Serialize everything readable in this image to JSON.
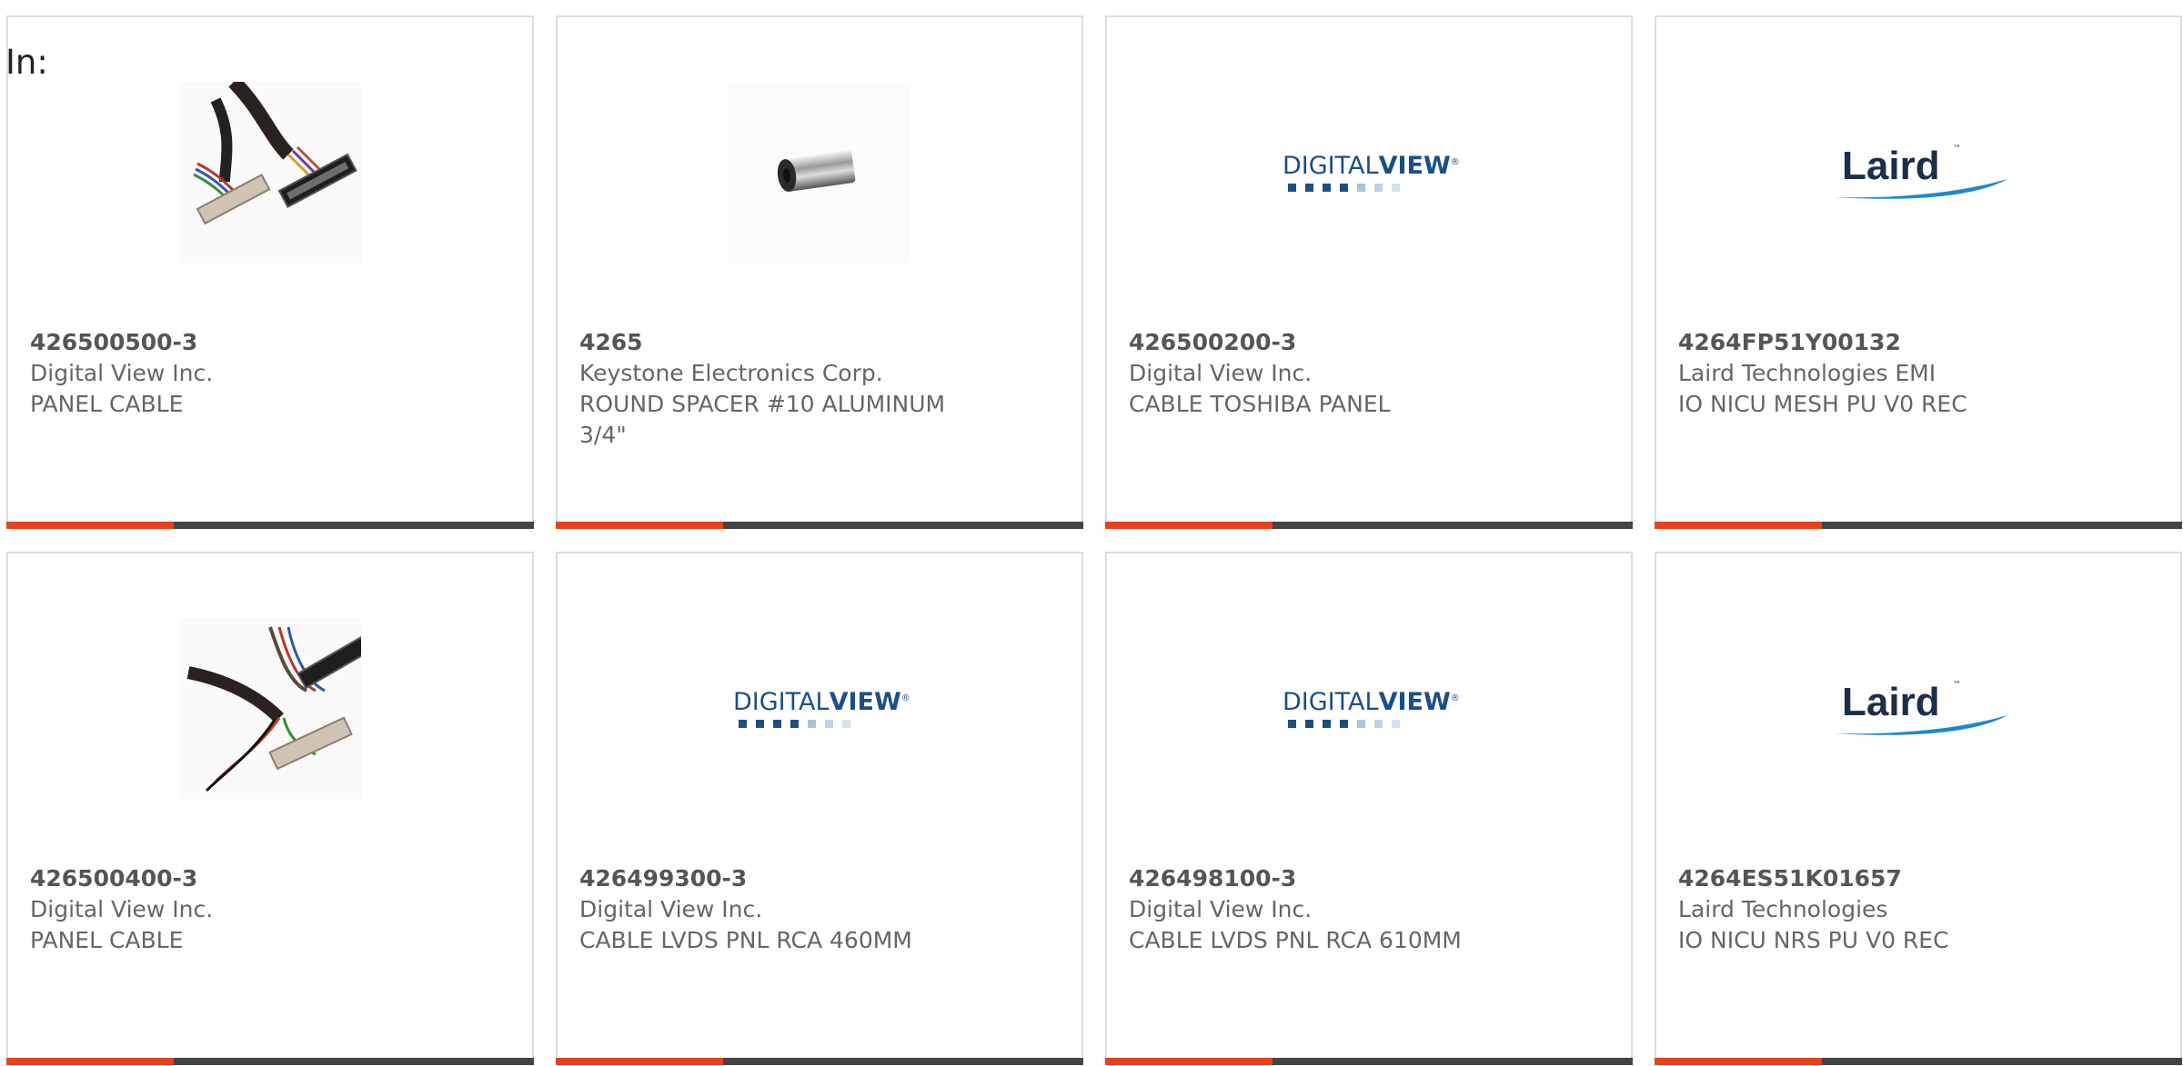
{
  "filter": {
    "label": "In:"
  },
  "colors": {
    "accent_bar": "#e8421c",
    "bar_rest": "#444444",
    "card_border": "#dddddd",
    "text_gray": "#666666",
    "digitalview_blue": "#1b4f86",
    "digitalview_light": "#9bb4cc",
    "laird_navy": "#1c2e4a",
    "laird_swoosh": "#1e88d0"
  },
  "products": [
    {
      "part_number": "426500500-3",
      "manufacturer": "Digital View Inc.",
      "description": "PANEL CABLE",
      "image": "cable-assembly-image"
    },
    {
      "part_number": "4265",
      "manufacturer": "Keystone Electronics Corp.",
      "description": "ROUND SPACER #10 ALUMINUM 3/4\"",
      "image": "round-spacer-image"
    },
    {
      "part_number": "426500200-3",
      "manufacturer": "Digital View Inc.",
      "description": "CABLE TOSHIBA PANEL",
      "image": "digitalview-logo",
      "logo_text_a": "DIGITAL",
      "logo_text_b": "VIEW",
      "logo_mark": "®"
    },
    {
      "part_number": "4264FP51Y00132",
      "manufacturer": "Laird Technologies EMI",
      "description": "IO NICU MESH PU V0 REC",
      "image": "laird-logo",
      "logo_text": "Laird",
      "logo_mark": "™"
    },
    {
      "part_number": "426500400-3",
      "manufacturer": "Digital View Inc.",
      "description": "PANEL CABLE",
      "image": "cable-assembly-image"
    },
    {
      "part_number": "426499300-3",
      "manufacturer": "Digital View Inc.",
      "description": "CABLE LVDS PNL RCA 460MM",
      "image": "digitalview-logo",
      "logo_text_a": "DIGITAL",
      "logo_text_b": "VIEW",
      "logo_mark": "®"
    },
    {
      "part_number": "426498100-3",
      "manufacturer": "Digital View Inc.",
      "description": "CABLE LVDS PNL RCA 610MM",
      "image": "digitalview-logo",
      "logo_text_a": "DIGITAL",
      "logo_text_b": "VIEW",
      "logo_mark": "®"
    },
    {
      "part_number": "4264ES51K01657",
      "manufacturer": "Laird Technologies",
      "description": "IO NICU NRS PU V0 REC",
      "image": "laird-logo",
      "logo_text": "Laird",
      "logo_mark": "™"
    }
  ]
}
